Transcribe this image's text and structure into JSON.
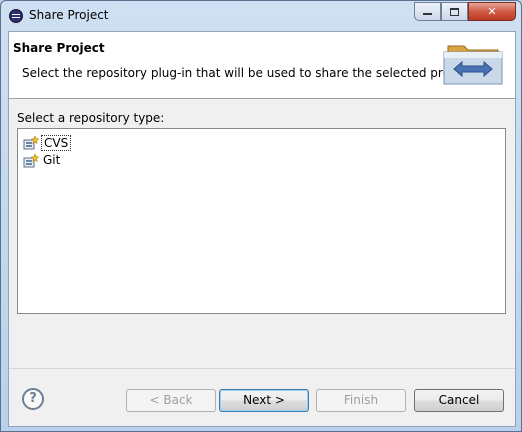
{
  "window": {
    "title": "Share Project"
  },
  "header": {
    "title": "Share Project",
    "description": "Select the repository plug-in that will be used to share the selected project."
  },
  "repository": {
    "label": "Select a repository type:",
    "items": [
      {
        "label": "CVS",
        "icon": "repository-plugin-icon",
        "selected": true
      },
      {
        "label": "Git",
        "icon": "repository-plugin-icon",
        "selected": false
      }
    ]
  },
  "buttons": {
    "help": "?",
    "back": "< Back",
    "next": "Next >",
    "finish": "Finish",
    "cancel": "Cancel"
  },
  "colors": {
    "title_bar": "#b9d1ea",
    "close_button": "#c7432c",
    "default_button_border": "#3c7fb1"
  }
}
